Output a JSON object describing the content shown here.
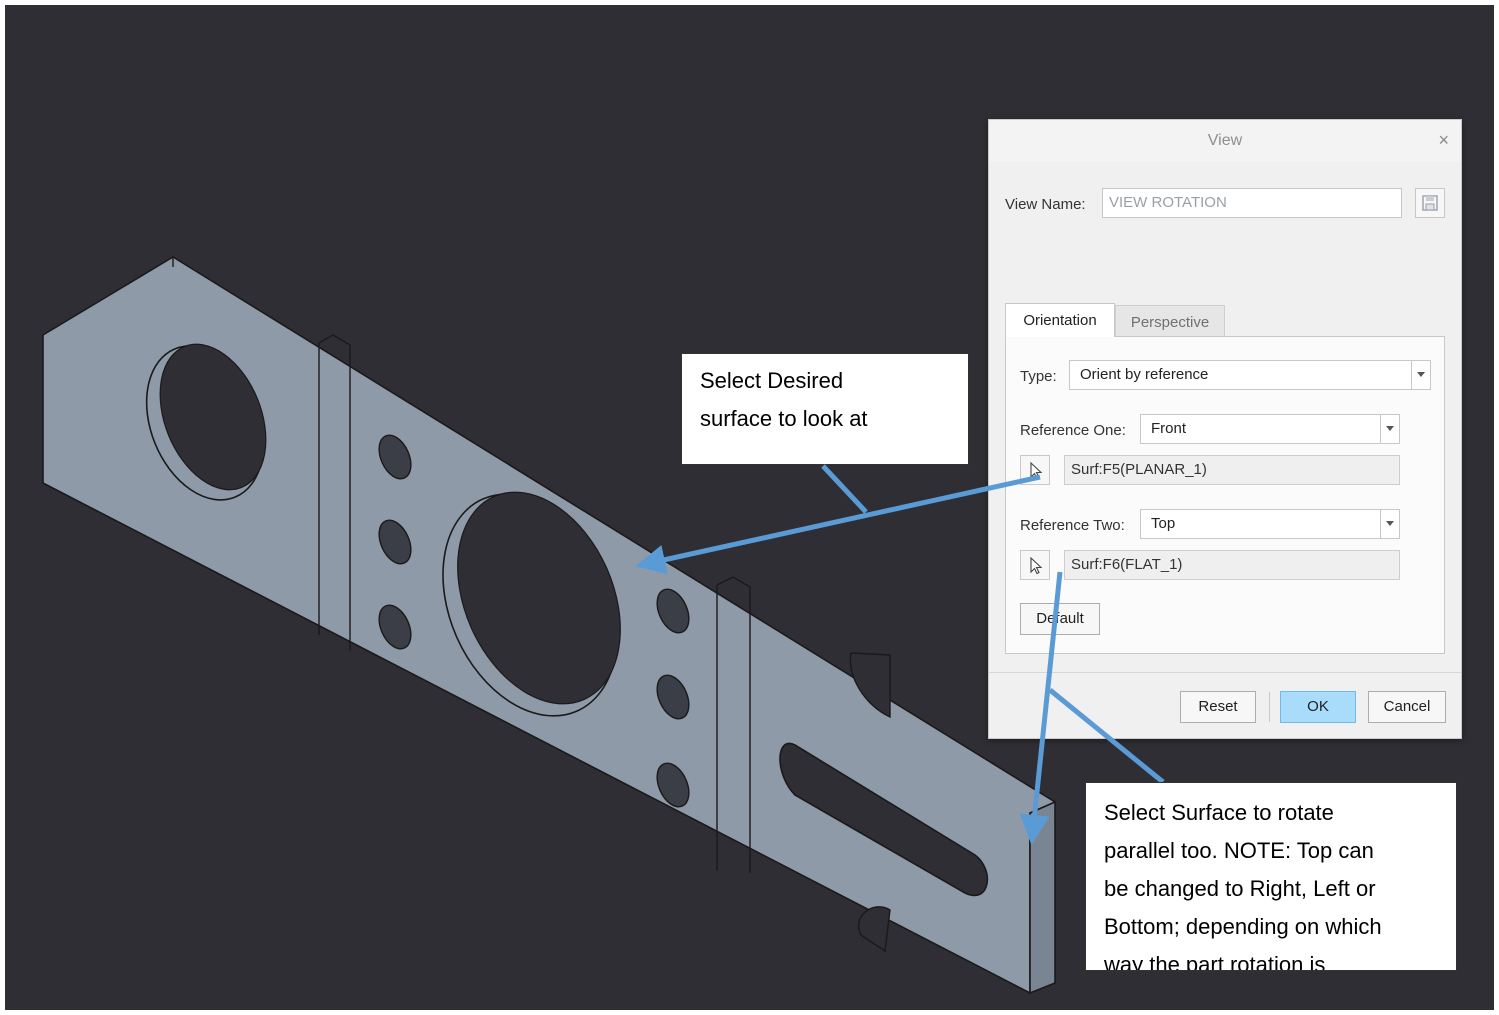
{
  "colors": {
    "viewport_bg": "#2e2e34",
    "part_face": "#8f9aa8",
    "part_edge": "#1a1a1a",
    "hole_shadow": "#3b3e46",
    "arrow": "#5b9bd5",
    "ok_button": "#a9dcfb"
  },
  "dialog": {
    "title": "View",
    "close_icon": "×",
    "view_name_label": "View Name:",
    "view_name_placeholder": "VIEW ROTATION",
    "tabs": [
      {
        "label": "Orientation",
        "active": true
      },
      {
        "label": "Perspective",
        "active": false
      }
    ],
    "type_label": "Type:",
    "type_value": "Orient by reference",
    "reference_one_label": "Reference One:",
    "reference_one_value": "Front",
    "reference_one_selection": "Surf:F5(PLANAR_1)",
    "reference_two_label": "Reference Two:",
    "reference_two_value": "Top",
    "reference_two_selection": "Surf:F6(FLAT_1)",
    "default_button": "Default",
    "reset_button": "Reset",
    "ok_button": "OK",
    "cancel_button": "Cancel"
  },
  "callouts": {
    "first": [
      "Select Desired",
      "surface to look at"
    ],
    "second": [
      "Select Surface to rotate",
      "parallel too.  NOTE: Top can",
      "be changed to Right, Left or",
      "Bottom; depending on which",
      "way the part rotation is"
    ]
  }
}
